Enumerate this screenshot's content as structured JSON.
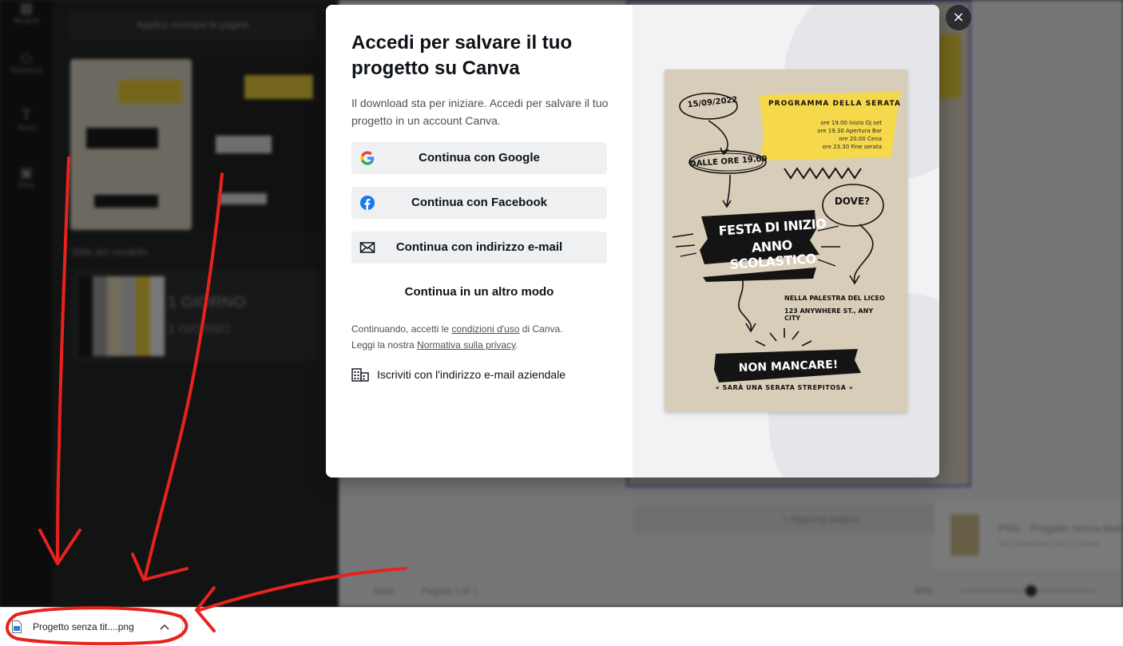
{
  "background_app": {
    "rail_items": [
      "Modelli",
      "Elementi",
      "Testo",
      "Foto"
    ],
    "apply_all_label": "Applica ovunque le pagine",
    "style_label": "Stile del modello",
    "style_font_big": "1 GIORNO",
    "style_font_small": "1 GIORNO",
    "add_page_label": "+ Aggiungi pagina",
    "download_card_title": "PNG · Progetto senza titolo",
    "download_card_sub": "Se il download non è iniziato",
    "notes_label": "Note",
    "page_counter": "Pagina 1 di 1",
    "zoom_label": "33%"
  },
  "modal": {
    "title": "Accedi per salvare il tuo progetto su Canva",
    "subtitle": "Il download sta per iniziare. Accedi per salvare il tuo progetto in un account Canva.",
    "buttons": {
      "google": "Continua con Google",
      "facebook": "Continua con Facebook",
      "email": "Continua con indirizzo e-mail"
    },
    "other_way": "Continua in un altro modo",
    "legal": {
      "prefix": "Continuando, accetti le ",
      "terms_link": "condizioni d'uso",
      "middle": " di Canva.",
      "line2_prefix": "Leggi la nostra ",
      "privacy_link": "Normativa sulla privacy",
      "suffix": "."
    },
    "business_signup": "Iscriviti con l'indirizzo e-mail aziendale",
    "close_icon": "×"
  },
  "poster": {
    "date": "15/09/2022",
    "program_title": "PROGRAMMA DELLA SERATA",
    "program_lines": [
      "ore 19.00 Inizio Dj set",
      "ore 19.30 Apertura Bar",
      "ore 20.00 Cena",
      "ore 23.30 Fine serata"
    ],
    "time": "DALLE ORE 19.00",
    "where": "DOVE?",
    "event_line1": "FESTA DI INIZIO",
    "event_line2": "ANNO SCOLASTICO",
    "place_line1": "NELLA PALESTRA DEL LICEO",
    "place_line2": "123 ANYWHERE ST., ANY CITY",
    "cta": "NON MANCARE!",
    "tagline": "« SARÀ UNA SERATA STREPITOSA »"
  },
  "download_bar": {
    "file_name": "Progetto senza tit....png",
    "chevron": "^"
  },
  "colors": {
    "accent_yellow": "#f6d94a",
    "annotation_red": "#e8221c",
    "facebook_blue": "#1877f2"
  }
}
